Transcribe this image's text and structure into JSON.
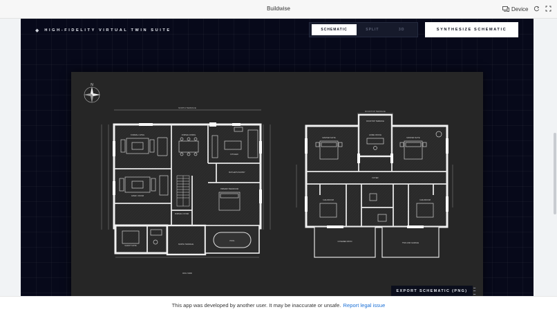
{
  "window": {
    "title": "Buildwise"
  },
  "toolbar": {
    "device_label": "Device"
  },
  "app": {
    "brand": "HIGH-FIDELITY VIRTUAL TWIN SUITE",
    "view_modes": [
      {
        "label": "SCHEMATIC",
        "active": true
      },
      {
        "label": "SPLIT",
        "active": false
      },
      {
        "label": "3D",
        "active": false
      }
    ],
    "synthesize_label": "SYNTHESIZE SCHEMATIC",
    "export_label": "EXPORT SCHEMATIC (PNG)"
  },
  "plan": {
    "compass": "N",
    "ground": {
      "top_label": "NORTH TERRACE",
      "bottom_label": "DOG YARD",
      "rooms": [
        {
          "name": "FORMAL LIVING",
          "sub": "6M X 5M"
        },
        {
          "name": "FORMAL DINING",
          "sub": "5M X 4M"
        },
        {
          "name": "KITCHEN",
          "sub": "6M X 4M"
        },
        {
          "name": "FAMILY ROOM",
          "sub": "6M X 5M"
        },
        {
          "name": "BUTLER'S PANTRY",
          "sub": ""
        },
        {
          "name": "GUEST SUITE",
          "sub": "4M X 4M"
        },
        {
          "name": "FORMAL FOYER",
          "sub": ""
        },
        {
          "name": "PRIMARY BEDROOM",
          "sub": ""
        },
        {
          "name": "NORTH TERRACE",
          "sub": ""
        },
        {
          "name": "POOL",
          "sub": ""
        }
      ]
    },
    "upper": {
      "top_label": "ROOFTOP TERRACE",
      "rooms": [
        {
          "name": "ROOFTOP TERRACE",
          "sub": ""
        },
        {
          "name": "HOME OFFICE",
          "sub": ""
        },
        {
          "name": "MASTER SUITE",
          "sub": ""
        },
        {
          "name": "MASTER SUITE",
          "sub": ""
        },
        {
          "name": "FOYER",
          "sub": ""
        },
        {
          "name": "CHILDROOM",
          "sub": ""
        },
        {
          "name": "CHILDROOM",
          "sub": ""
        },
        {
          "name": "COVERED PATIO",
          "sub": ""
        },
        {
          "name": "TWO-CAR GARAGE",
          "sub": ""
        }
      ]
    }
  },
  "notice": {
    "text": "This app was developed by another user. It may be inaccurate or unsafe.",
    "link": "Report legal issue"
  }
}
